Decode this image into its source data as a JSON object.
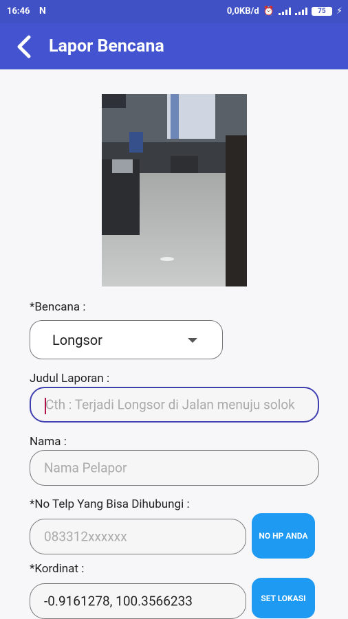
{
  "status_bar": {
    "time": "16:46",
    "notification_icon": "N",
    "network_speed": "0,0KB/d",
    "battery_level": "75"
  },
  "app_bar": {
    "title": "Lapor Bencana"
  },
  "form": {
    "bencana_label": "*Bencana :",
    "bencana_value": "Longsor",
    "judul_label": "Judul Laporan :",
    "judul_placeholder": "Cth : Terjadi Longsor di Jalan menuju solok",
    "nama_label": "Nama :",
    "nama_placeholder": "Nama Pelapor",
    "telp_label": "*No Telp Yang Bisa Dihubungi :",
    "telp_placeholder": "083312xxxxxx",
    "telp_button": "NO HP ANDA",
    "kordinat_label": "*Kordinat :",
    "kordinat_value": "-0.9161278, 100.3566233",
    "kordinat_button": "SET LOKASI"
  },
  "colors": {
    "primary": "#4454d0",
    "status_bar": "#3f51c4",
    "button": "#1e9af3",
    "focus_border": "#3f3fb0"
  }
}
